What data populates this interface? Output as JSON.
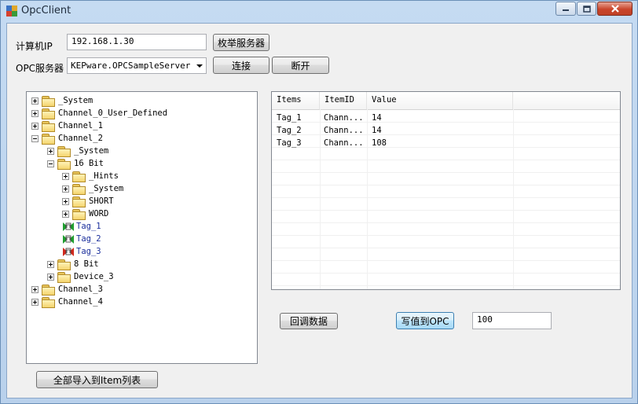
{
  "window": {
    "title": "OpcClient",
    "controls": [
      "minimize-icon",
      "maximize-icon",
      "close-icon"
    ]
  },
  "form": {
    "ip_label": "计算机IP",
    "ip_value": "192.168.1.30",
    "enum_button": "枚举服务器",
    "server_label": "OPC服务器",
    "server_selected": "KEPware.OPCSampleServer",
    "connect_button": "连接",
    "disconnect_button": "断开"
  },
  "tree": [
    {
      "label": "_System",
      "level": 0,
      "expander": "plus",
      "icon": "folder-icon"
    },
    {
      "label": "Channel_0_User_Defined",
      "level": 0,
      "expander": "plus",
      "icon": "folder-icon"
    },
    {
      "label": "Channel_1",
      "level": 0,
      "expander": "plus",
      "icon": "folder-icon"
    },
    {
      "label": "Channel_2",
      "level": 0,
      "expander": "minus",
      "icon": "folder-icon"
    },
    {
      "label": "_System",
      "level": 1,
      "expander": "plus",
      "icon": "folder-icon"
    },
    {
      "label": "16 Bit",
      "level": 1,
      "expander": "minus",
      "icon": "folder-icon"
    },
    {
      "label": "_Hints",
      "level": 2,
      "expander": "plus",
      "icon": "folder-icon"
    },
    {
      "label": "_System",
      "level": 2,
      "expander": "plus",
      "icon": "folder-icon"
    },
    {
      "label": "SHORT",
      "level": 2,
      "expander": "plus",
      "icon": "folder-icon"
    },
    {
      "label": "WORD",
      "level": 2,
      "expander": "plus",
      "icon": "folder-icon"
    },
    {
      "label": "Tag_1",
      "level": 2,
      "expander": "none",
      "icon": "tag-green-icon"
    },
    {
      "label": "Tag_2",
      "level": 2,
      "expander": "none",
      "icon": "tag-green-icon"
    },
    {
      "label": "Tag_3",
      "level": 2,
      "expander": "none",
      "icon": "tag-red-icon"
    },
    {
      "label": "8 Bit",
      "level": 1,
      "expander": "plus",
      "icon": "folder-icon"
    },
    {
      "label": "Device_3",
      "level": 1,
      "expander": "plus",
      "icon": "folder-icon"
    },
    {
      "label": "Channel_3",
      "level": 0,
      "expander": "plus",
      "icon": "folder-icon"
    },
    {
      "label": "Channel_4",
      "level": 0,
      "expander": "plus",
      "icon": "folder-icon"
    }
  ],
  "list": {
    "columns": [
      "Items",
      "ItemID",
      "Value"
    ],
    "rows": [
      [
        "Tag_1",
        "Chann...",
        "14"
      ],
      [
        "Tag_2",
        "Chann...",
        "14"
      ],
      [
        "Tag_3",
        "Chann...",
        "108"
      ]
    ]
  },
  "actions": {
    "callback_button": "回调数据",
    "write_button": "写值到OPC",
    "write_value": "100",
    "import_button": "全部导入到Item列表"
  },
  "colors": {
    "tag_text": "#1b2f9c",
    "tag_green": "#1e9e2e",
    "tag_red": "#d0281c",
    "folder": "#f4d46e"
  }
}
